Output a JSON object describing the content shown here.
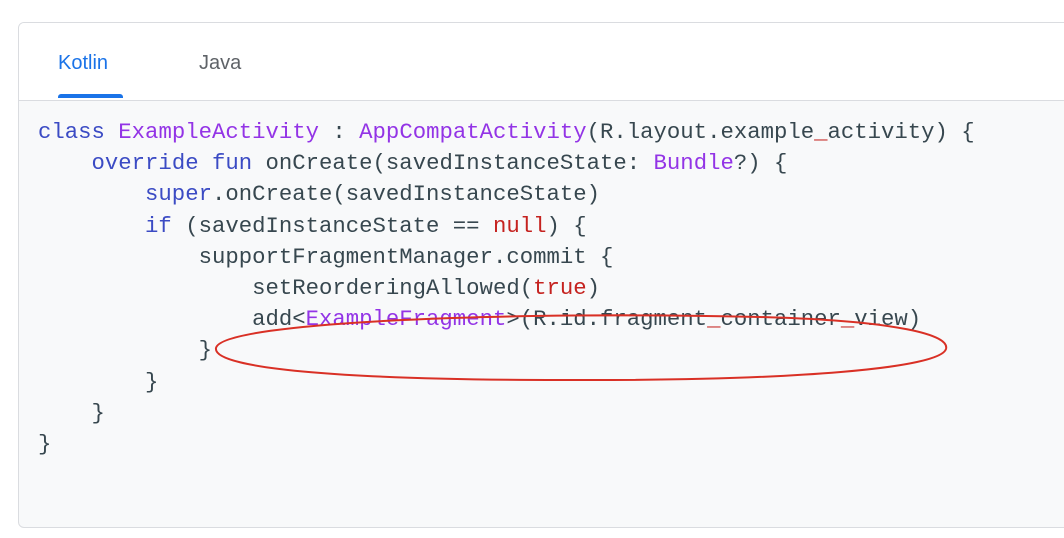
{
  "tabs": [
    {
      "label": "Kotlin",
      "active": true
    },
    {
      "label": "Java",
      "active": false
    }
  ],
  "code": {
    "l1": {
      "t1": "class",
      "t2": " ",
      "t3": "ExampleActivity",
      "t4": " : ",
      "t5": "AppCompatActivity",
      "t6": "(R.layout.example",
      "t7": "_",
      "t8": "activity) {"
    },
    "l2": {
      "indent": "    ",
      "t1": "override",
      "t2": " ",
      "t3": "fun",
      "t4": " onCreate(savedInstanceState: ",
      "t5": "Bundle",
      "t6": "?) {"
    },
    "l3": {
      "indent": "        ",
      "t1": "super",
      "t2": ".onCreate(savedInstanceState)"
    },
    "l4": {
      "indent": "        ",
      "t1": "if",
      "t2": " (savedInstanceState == ",
      "t3": "null",
      "t4": ") {"
    },
    "l5": {
      "indent": "            ",
      "t1": "supportFragmentManager.commit {"
    },
    "l6": {
      "indent": "                ",
      "t1": "setReorderingAllowed(",
      "t2": "true",
      "t3": ")"
    },
    "l7": {
      "indent": "                ",
      "t1": "add<",
      "t2": "ExampleFragment",
      "t3": ">(R.id.fragment",
      "t4": "_",
      "t5": "container",
      "t6": "_",
      "t7": "view)"
    },
    "l8": {
      "indent": "            ",
      "t1": "}"
    },
    "l9": {
      "indent": "        ",
      "t1": "}"
    },
    "l10": {
      "indent": "    ",
      "t1": "}"
    },
    "l11": {
      "t1": "}"
    }
  },
  "colors": {
    "active_tab": "#1a73e8",
    "keyword": "#3b4bc4",
    "type": "#9334e6",
    "literal": "#c5221f",
    "annotation": "#d93025"
  }
}
